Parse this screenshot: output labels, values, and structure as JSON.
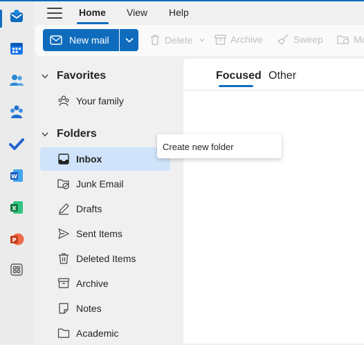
{
  "nav": {
    "tabs": [
      {
        "label": "Home",
        "active": true
      },
      {
        "label": "View",
        "active": false
      },
      {
        "label": "Help",
        "active": false
      }
    ]
  },
  "rail": {
    "apps": [
      "mail",
      "calendar",
      "people",
      "groups",
      "to-do",
      "word",
      "excel",
      "powerpoint",
      "more-apps"
    ]
  },
  "ribbon": {
    "new_mail": "New mail",
    "delete": "Delete",
    "archive": "Archive",
    "sweep": "Sweep",
    "move_partial": "Mo"
  },
  "favorites": {
    "heading": "Favorites",
    "items": [
      {
        "label": "Your family",
        "icon": "family-icon"
      }
    ]
  },
  "folders": {
    "heading": "Folders",
    "items": [
      {
        "label": "Inbox",
        "icon": "inbox-icon",
        "selected": true
      },
      {
        "label": "Junk Email",
        "icon": "junk-icon"
      },
      {
        "label": "Drafts",
        "icon": "drafts-icon"
      },
      {
        "label": "Sent Items",
        "icon": "sent-icon"
      },
      {
        "label": "Deleted Items",
        "icon": "trash-icon"
      },
      {
        "label": "Archive",
        "icon": "archive-icon"
      },
      {
        "label": "Notes",
        "icon": "notes-icon"
      },
      {
        "label": "Academic",
        "icon": "folder-icon"
      }
    ]
  },
  "message_list": {
    "tabs": [
      {
        "label": "Focused",
        "active": true
      },
      {
        "label": "Other",
        "active": false
      }
    ]
  },
  "tooltip": {
    "text": "Create new folder"
  },
  "colors": {
    "accent": "#0f6cbd",
    "selected": "#cfe4fa",
    "pane": "#f0f0f0"
  }
}
